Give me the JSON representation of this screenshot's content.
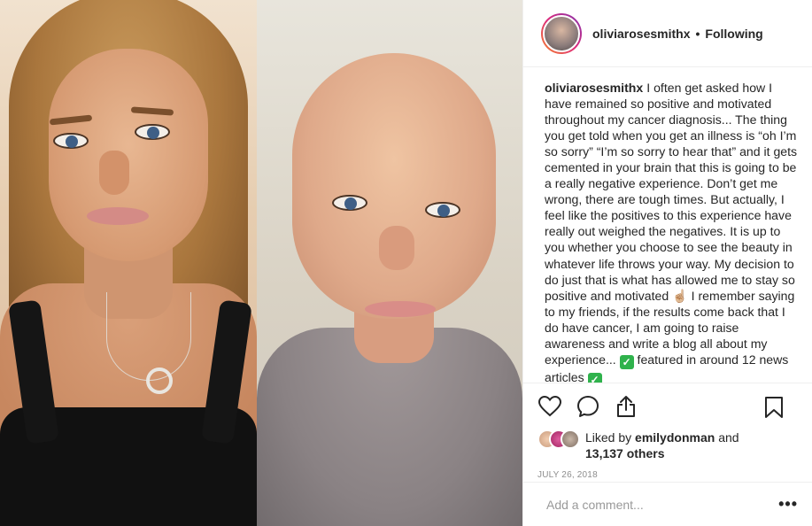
{
  "post": {
    "author": "oliviarosesmithx",
    "follow_status": "Following",
    "separator": "•"
  },
  "caption": {
    "username": "oliviarosesmithx",
    "text_parts": [
      "I often get asked how I have remained so positive and motivated throughout my cancer diagnosis... The thing you get told when you get an illness is “oh I’m so sorry” “I’m so sorry to hear that” and it gets cemented in your brain that this is going to be a really negative experience. Don’t get me wrong, there are tough times. But actually, I feel like the positives to this experience have really out weighed the negatives. It is up to you whether you choose to see the beauty in whatever life throws your way. My decision to do just that is what has allowed me to stay so positive and motivated",
      "☝🏼",
      "I remember saying to my friends, if the results come back that I do have cancer, I am going to raise awareness and write a blog all about my experience...",
      "✓",
      "featured in around 12 news articles",
      "✓"
    ]
  },
  "actions": {
    "like_icon": "heart-icon",
    "comment_icon": "comment-icon",
    "share_icon": "share-icon",
    "save_icon": "bookmark-icon"
  },
  "likes": {
    "prefix": "Liked by",
    "user": "emilydonman",
    "conj": "and",
    "count_text": "13,137 others"
  },
  "date": "JULY 26, 2018",
  "comment": {
    "placeholder": "Add a comment...",
    "more": "•••"
  },
  "colors": {
    "text": "#262626",
    "muted": "#8e8e8e",
    "border": "#efefef",
    "check_green": "#2fb24c"
  }
}
